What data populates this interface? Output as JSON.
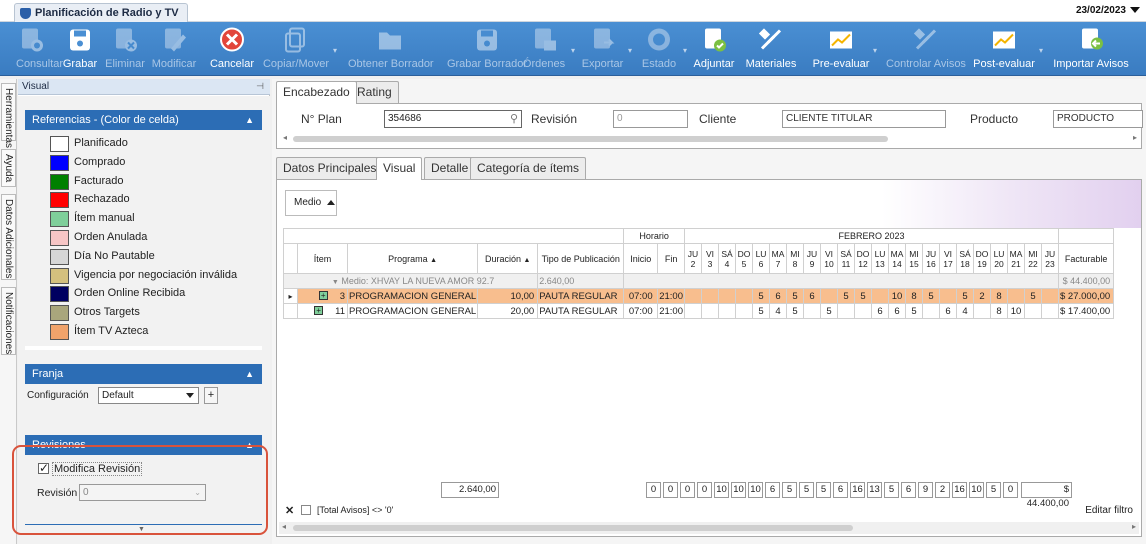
{
  "window": {
    "tab_title": "Planificación de Radio y TV",
    "date": "23/02/2023"
  },
  "toolbar": [
    {
      "label": "Consultar",
      "enabled": false,
      "icon": "consult-icon",
      "dropdown": false
    },
    {
      "label": "Grabar",
      "enabled": true,
      "icon": "save-icon",
      "dropdown": false
    },
    {
      "label": "Eliminar",
      "enabled": false,
      "icon": "delete-icon",
      "dropdown": false
    },
    {
      "label": "Modificar",
      "enabled": false,
      "icon": "edit-icon",
      "dropdown": false
    },
    {
      "label": "Cancelar",
      "enabled": true,
      "icon": "cancel-icon",
      "dropdown": false
    },
    {
      "label": "Copiar/Mover",
      "enabled": false,
      "icon": "copy-icon",
      "dropdown": true
    },
    {
      "label": "Obtener Borrador",
      "enabled": false,
      "icon": "folder-icon",
      "dropdown": false
    },
    {
      "label": "Grabar Borrador",
      "enabled": false,
      "icon": "save-draft-icon",
      "dropdown": false
    },
    {
      "label": "Órdenes",
      "enabled": false,
      "icon": "orders-icon",
      "dropdown": true
    },
    {
      "label": "Exportar",
      "enabled": false,
      "icon": "export-icon",
      "dropdown": true
    },
    {
      "label": "Estado",
      "enabled": false,
      "icon": "status-icon",
      "dropdown": true
    },
    {
      "label": "Adjuntar",
      "enabled": true,
      "icon": "attach-icon",
      "dropdown": false
    },
    {
      "label": "Materiales",
      "enabled": true,
      "icon": "tools-icon",
      "dropdown": false
    },
    {
      "label": "Pre-evaluar",
      "enabled": true,
      "icon": "chart-icon",
      "dropdown": true
    },
    {
      "label": "Controlar Avisos",
      "enabled": false,
      "icon": "tools-icon",
      "dropdown": false
    },
    {
      "label": "Post-evaluar",
      "enabled": true,
      "icon": "chart-icon",
      "dropdown": true
    },
    {
      "label": "Importar Avisos",
      "enabled": true,
      "icon": "import-icon",
      "dropdown": false
    }
  ],
  "side_tabs": [
    "Herramientas",
    "Ayuda",
    "Datos Adicionales",
    "Notificaciones"
  ],
  "left_panel": {
    "title": "Visual",
    "references": {
      "header": "Referencias - (Color de celda)",
      "items": [
        {
          "label": "Planificado",
          "color": "#ffffff"
        },
        {
          "label": "Comprado",
          "color": "#0000ff"
        },
        {
          "label": "Facturado",
          "color": "#008000"
        },
        {
          "label": "Rechazado",
          "color": "#ff0000"
        },
        {
          "label": "Ítem manual",
          "color": "#7fcf9a"
        },
        {
          "label": "Orden Anulada",
          "color": "#f6c5c5"
        },
        {
          "label": "Día No Pautable",
          "color": "#d6d6d6"
        },
        {
          "label": "Vigencia por negociación inválida",
          "color": "#d4c07e"
        },
        {
          "label": "Orden Online Recibida",
          "color": "#000060"
        },
        {
          "label": "Otros Targets",
          "color": "#a9a67c"
        },
        {
          "label": "Ítem TV Azteca",
          "color": "#f0a36b"
        }
      ]
    },
    "franja": {
      "header": "Franja",
      "config_label": "Configuración",
      "config_value": "Default",
      "add_label": "+"
    },
    "revisiones": {
      "header": "Revisiones",
      "checkbox_label": "Modifica Revisión",
      "checked": true,
      "revision_label": "Revisión",
      "revision_value": "0"
    }
  },
  "header_tabs": [
    {
      "label": "Encabezado",
      "active": true
    },
    {
      "label": "Rating",
      "active": false
    }
  ],
  "header": {
    "plan_label": "N° Plan",
    "plan_value": "354686",
    "revision_label": "Revisión",
    "revision_value": "0",
    "client_label": "Cliente",
    "client_value": "CLIENTE TITULAR",
    "product_label": "Producto",
    "product_value": "PRODUCTO"
  },
  "content_tabs": [
    {
      "label": "Datos Principales",
      "active": false
    },
    {
      "label": "Visual",
      "active": true
    },
    {
      "label": "Detalle",
      "active": false
    },
    {
      "label": "Categoría de ítems",
      "active": false
    }
  ],
  "grid": {
    "medio_button": "Medio",
    "horario_label": "Horario",
    "month_label": "FEBRERO 2023",
    "columns": {
      "item": "Ítem",
      "programa": "Programa",
      "duracion": "Duración",
      "tipo": "Tipo de Publicación",
      "inicio": "Inicio",
      "fin": "Fin",
      "facturable": "Facturable"
    },
    "days": [
      [
        "JU",
        "2"
      ],
      [
        "VI",
        "3"
      ],
      [
        "SÁ",
        "4"
      ],
      [
        "DO",
        "5"
      ],
      [
        "LU",
        "6"
      ],
      [
        "MA",
        "7"
      ],
      [
        "MI",
        "8"
      ],
      [
        "JU",
        "9"
      ],
      [
        "VI",
        "10"
      ],
      [
        "SÁ",
        "11"
      ],
      [
        "DO",
        "12"
      ],
      [
        "LU",
        "13"
      ],
      [
        "MA",
        "14"
      ],
      [
        "MI",
        "15"
      ],
      [
        "JU",
        "16"
      ],
      [
        "VI",
        "17"
      ],
      [
        "SÁ",
        "18"
      ],
      [
        "DO",
        "19"
      ],
      [
        "LU",
        "20"
      ],
      [
        "MA",
        "21"
      ],
      [
        "MI",
        "22"
      ],
      [
        "JU",
        "23"
      ]
    ],
    "group": {
      "label": "Medio: XHVAY LA NUEVA AMOR 92.7",
      "duration": "2.640,00",
      "facturable": "$ 44.400,00"
    },
    "rows": [
      {
        "item": "3",
        "programa": "PROGRAMACION GENERAL",
        "duracion": "10,00",
        "tipo": "PAUTA REGULAR",
        "inicio": "07:00",
        "fin": "21:00",
        "days": [
          "",
          "",
          "",
          "",
          "5",
          "6",
          "5",
          "6",
          "",
          "5",
          "5",
          "",
          "10",
          "8",
          "5",
          "",
          "5",
          "2",
          "8",
          "",
          "5",
          ""
        ],
        "facturable": "$ 27.000,00",
        "selected": true
      },
      {
        "item": "11",
        "programa": "PROGRAMACION GENERAL",
        "duracion": "20,00",
        "tipo": "PAUTA REGULAR",
        "inicio": "07:00",
        "fin": "21:00",
        "days": [
          "",
          "",
          "",
          "",
          "5",
          "4",
          "5",
          "",
          "5",
          "",
          "",
          "6",
          "6",
          "5",
          "",
          "6",
          "4",
          "",
          "8",
          "10",
          "",
          ""
        ],
        "facturable": "$ 17.400,00",
        "selected": false
      }
    ],
    "totals": {
      "duracion": "2.640,00",
      "days": [
        "0",
        "0",
        "0",
        "0",
        "10",
        "10",
        "10",
        "6",
        "5",
        "5",
        "5",
        "6",
        "16",
        "13",
        "5",
        "6",
        "9",
        "2",
        "16",
        "10",
        "5",
        "0"
      ],
      "facturable": "$ 44.400,00"
    },
    "filter_text": "[Total Avisos] <> '0'",
    "edit_filter": "Editar filtro"
  }
}
